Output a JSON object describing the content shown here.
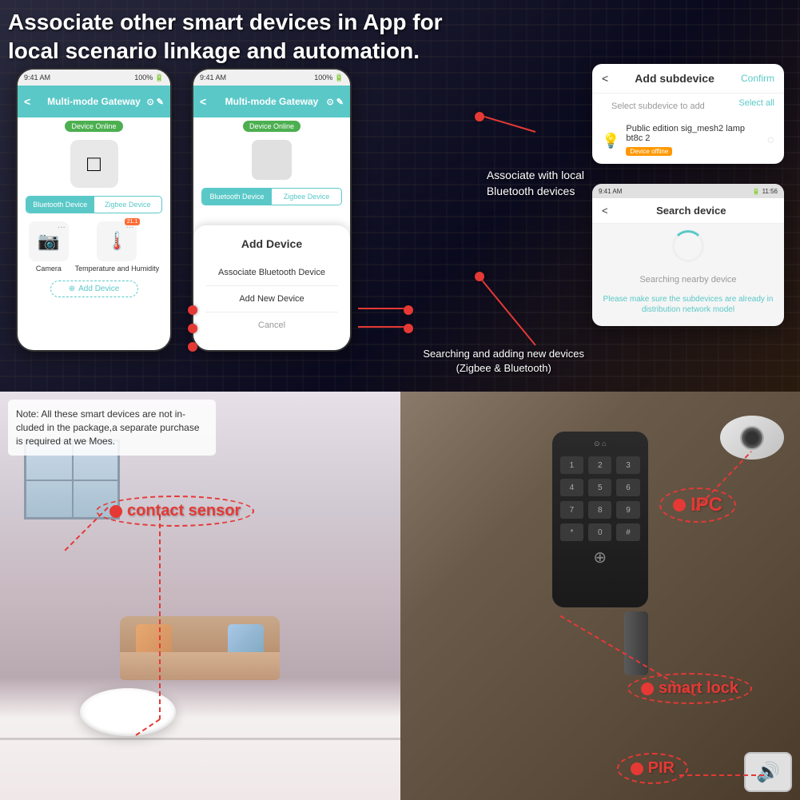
{
  "header": {
    "title": "Associate other smart devices in App for local scenario linkage and automation."
  },
  "phone1": {
    "status_bar": "9:41 AM",
    "title": "Multi-mode Gateway",
    "online_status": "Device Online",
    "tab_bluetooth": "Bluetooth Device",
    "tab_zigbee": "Zigbee Device",
    "device1_label": "Camera",
    "device2_label": "Temperature and Humidity",
    "add_device": "Add Device"
  },
  "phone2": {
    "status_bar": "9:41 AM",
    "title": "Multi-mode Gateway",
    "online_status": "Device Online",
    "tab_bluetooth": "Bluetooth Device",
    "tab_zigbee": "Zigbee Device",
    "dialog_title": "Add Device",
    "option1": "Associate Bluetooth Device",
    "option2": "Add New Device",
    "cancel": "Cancel"
  },
  "subdevice_panel": {
    "title": "Add subdevice",
    "confirm": "Confirm",
    "select_label": "Select subdevice to add",
    "select_all": "Select all",
    "device_name": "Public edition sig_mesh2 lamp bt8c 2",
    "device_status": "Device offline"
  },
  "search_panel": {
    "status_bar": "9:41 AM",
    "title": "Search device",
    "searching_text": "Searching nearby device",
    "note": "Please make sure the subdevices are already in distribution network model"
  },
  "annotations": {
    "bluetooth": "Associate with local\nBluetooth devices",
    "searching": "Searching and adding new devices\n(Zigbee & Bluetooth)"
  },
  "bottom": {
    "note": "Note: All these smart devices are not in-\ncluded in the package,a separate purchase\nis required at we Moes.",
    "contact_sensor": "contact sensor",
    "ipc": "IPC",
    "smart_lock": "smart lock",
    "pir": "PIR"
  }
}
